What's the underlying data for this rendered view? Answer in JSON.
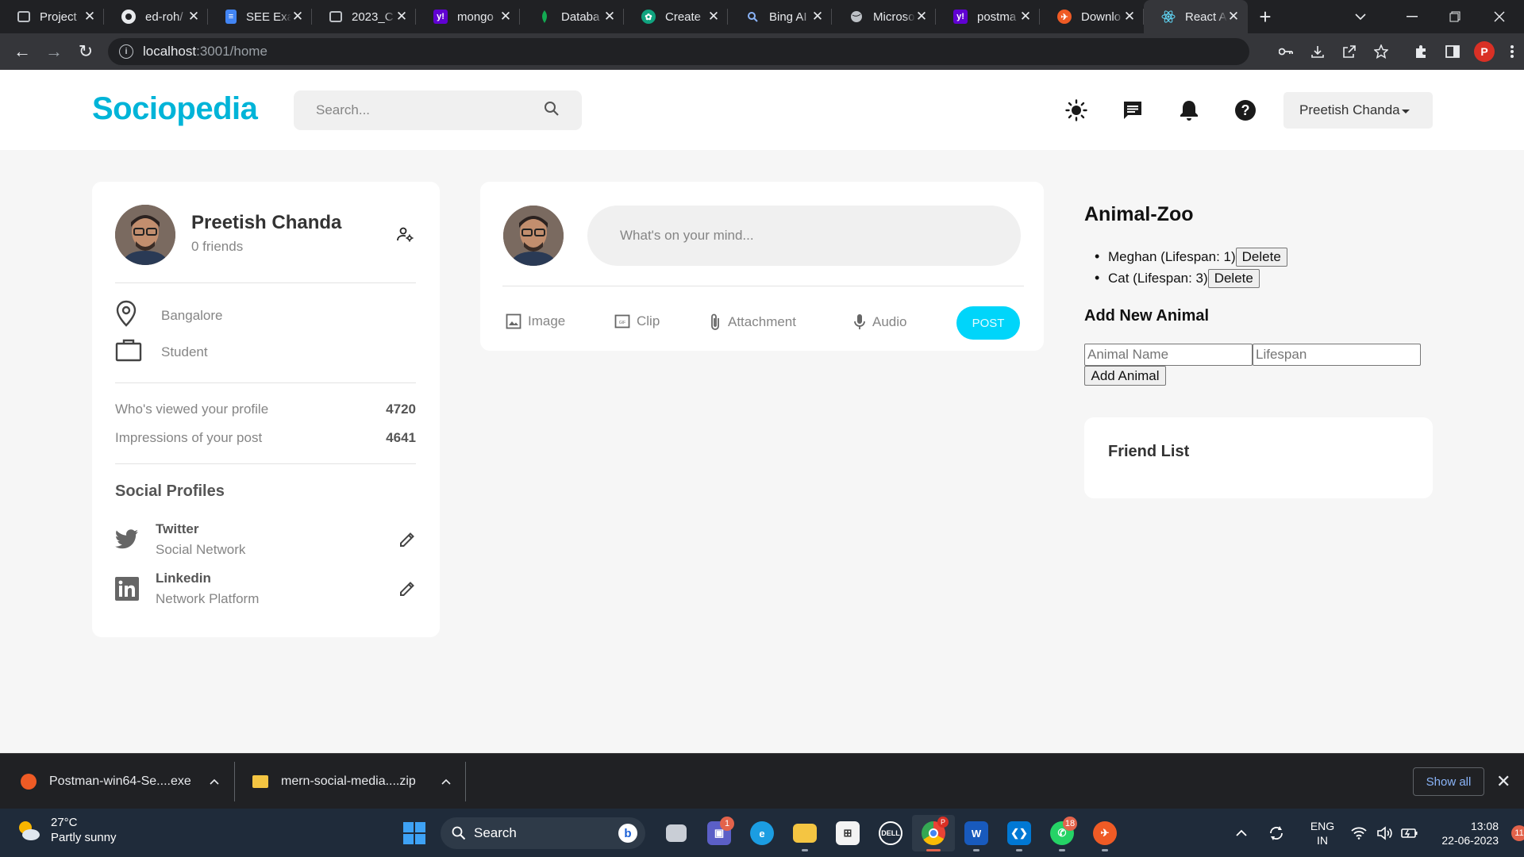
{
  "browser": {
    "tabs": [
      {
        "title": "Project",
        "icon": "classroom-icon",
        "color": "#5f6368"
      },
      {
        "title": "ed-roh/",
        "icon": "github-icon",
        "color": "#202124"
      },
      {
        "title": "SEE Exa",
        "icon": "docs-icon",
        "color": "#4285f4"
      },
      {
        "title": "2023_C",
        "icon": "classroom-icon",
        "color": "#5f6368"
      },
      {
        "title": "mongo",
        "icon": "yahoo-icon",
        "color": "#6001d2"
      },
      {
        "title": "Databa",
        "icon": "mongodb-icon",
        "color": "#13aa52"
      },
      {
        "title": "Create",
        "icon": "chatgpt-icon",
        "color": "#10a37f"
      },
      {
        "title": "Bing AI",
        "icon": "bing-search-icon",
        "color": "#202124"
      },
      {
        "title": "Microso",
        "icon": "globe-icon",
        "color": "#202124"
      },
      {
        "title": "postma",
        "icon": "yahoo-icon",
        "color": "#6001d2"
      },
      {
        "title": "Downlo",
        "icon": "postman-icon",
        "color": "#ef5b25"
      },
      {
        "title": "React A",
        "icon": "react-icon",
        "color": "#35363a"
      }
    ],
    "url_host": "localhost",
    "url_path": ":3001/home",
    "profile_initial": "P"
  },
  "nav": {
    "logo": "Sociopedia",
    "search_placeholder": "Search...",
    "user_name": "Preetish Chanda"
  },
  "profile": {
    "name": "Preetish Chanda",
    "friends": "0 friends",
    "location": "Bangalore",
    "occupation": "Student",
    "stats": [
      {
        "label": "Who's viewed your profile",
        "value": "4720"
      },
      {
        "label": "Impressions of your post",
        "value": "4641"
      }
    ],
    "social_title": "Social Profiles",
    "socials": [
      {
        "name": "Twitter",
        "sub": "Social Network"
      },
      {
        "name": "Linkedin",
        "sub": "Network Platform"
      }
    ]
  },
  "post": {
    "placeholder": "What's on your mind...",
    "actions": [
      "Image",
      "Clip",
      "Attachment",
      "Audio"
    ],
    "post_label": "POST"
  },
  "zoo": {
    "title": "Animal-Zoo",
    "animals": [
      {
        "text": "Meghan (Lifespan: 1)",
        "delete": "Delete"
      },
      {
        "text": "Cat (Lifespan: 3)",
        "delete": "Delete"
      }
    ],
    "add_title": "Add New Animal",
    "name_placeholder": "Animal Name",
    "lifespan_placeholder": "Lifespan",
    "add_label": "Add Animal"
  },
  "friends": {
    "title": "Friend List"
  },
  "downloads": {
    "items": [
      "Postman-win64-Se....exe",
      "mern-social-media....zip"
    ],
    "show_all": "Show all"
  },
  "taskbar": {
    "temp": "27°C",
    "weather": "Partly sunny",
    "search": "Search",
    "teams_badge": "1",
    "whatsapp_badge": "18",
    "lang1": "ENG",
    "lang2": "IN",
    "time": "13:08",
    "date": "22-06-2023",
    "notif": "11"
  },
  "colors": {
    "brand": "#00b4d8",
    "post_button": "#00d5fa",
    "card_bg": "#ffffff",
    "page_bg": "#f6f6f6"
  }
}
